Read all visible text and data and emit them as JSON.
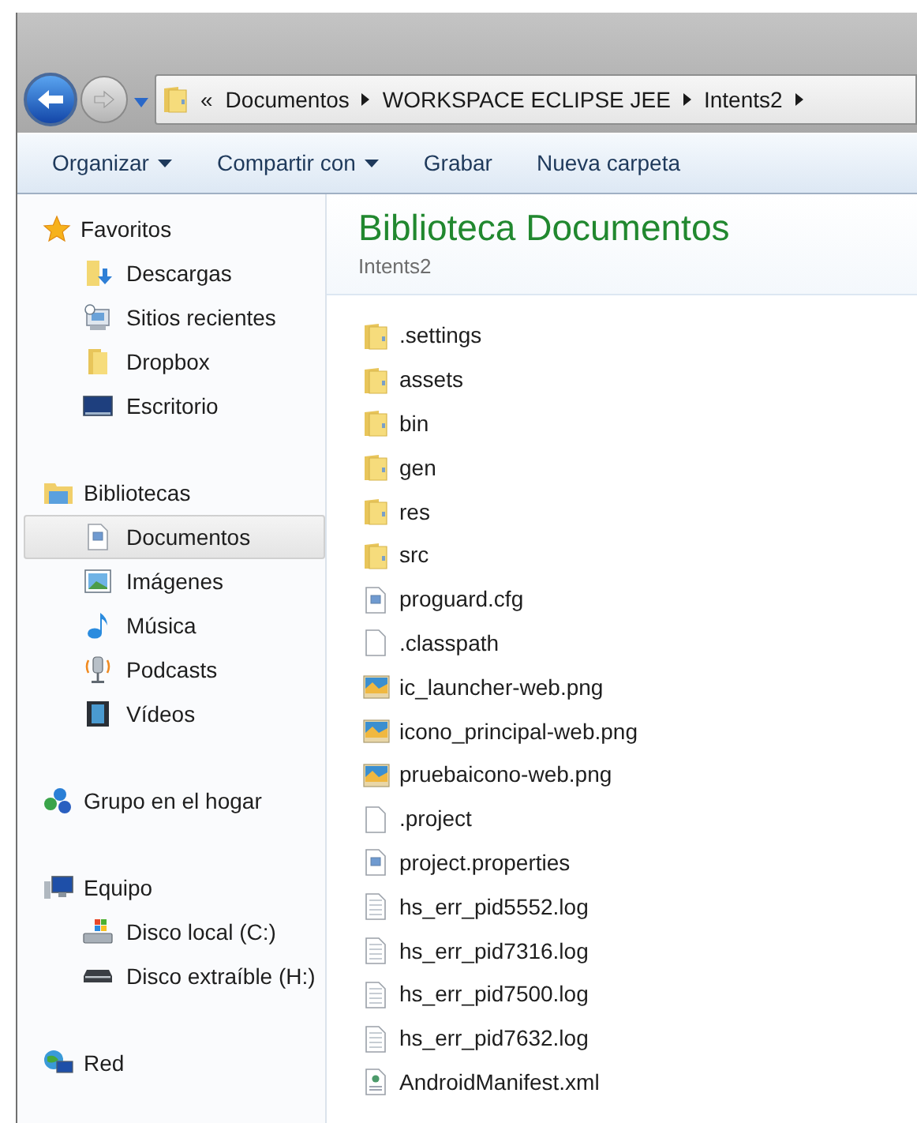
{
  "navigation": {
    "breadcrumb": [
      "«",
      "Documentos",
      "WORKSPACE ECLIPSE JEE",
      "Intents2"
    ]
  },
  "toolbar": [
    {
      "label": "Organizar",
      "dropdown": true
    },
    {
      "label": "Compartir con",
      "dropdown": true
    },
    {
      "label": "Grabar",
      "dropdown": false
    },
    {
      "label": "Nueva carpeta",
      "dropdown": false
    }
  ],
  "sidebar": {
    "groups": [
      {
        "label": "Favoritos",
        "children": [
          {
            "label": "Descargas",
            "selected": false
          },
          {
            "label": "Sitios recientes",
            "selected": false
          },
          {
            "label": "Dropbox",
            "selected": false
          },
          {
            "label": "Escritorio",
            "selected": false
          }
        ]
      },
      {
        "label": "Bibliotecas",
        "children": [
          {
            "label": "Documentos",
            "selected": true
          },
          {
            "label": "Imágenes",
            "selected": false
          },
          {
            "label": "Música",
            "selected": false
          },
          {
            "label": "Podcasts",
            "selected": false
          },
          {
            "label": "Vídeos",
            "selected": false
          }
        ]
      },
      {
        "label": "Grupo en el hogar"
      },
      {
        "label": "Equipo",
        "children": [
          {
            "label": "Disco local (C:)",
            "selected": false
          },
          {
            "label": "Disco extraíble (H:)",
            "selected": false
          }
        ]
      },
      {
        "label": "Red"
      }
    ]
  },
  "content": {
    "title": "Biblioteca Documentos",
    "subtitle": "Intents2",
    "files": [
      {
        "name": ".settings",
        "kind": "folder"
      },
      {
        "name": "assets",
        "kind": "folder"
      },
      {
        "name": "bin",
        "kind": "folder"
      },
      {
        "name": "gen",
        "kind": "folder"
      },
      {
        "name": "res",
        "kind": "folder"
      },
      {
        "name": "src",
        "kind": "folder"
      },
      {
        "name": "proguard.cfg",
        "kind": "config"
      },
      {
        "name": ".classpath",
        "kind": "blank"
      },
      {
        "name": "ic_launcher-web.png",
        "kind": "image"
      },
      {
        "name": "icono_principal-web.png",
        "kind": "image"
      },
      {
        "name": "pruebaicono-web.png",
        "kind": "image"
      },
      {
        "name": ".project",
        "kind": "blank"
      },
      {
        "name": "project.properties",
        "kind": "config"
      },
      {
        "name": "hs_err_pid5552.log",
        "kind": "log"
      },
      {
        "name": "hs_err_pid7316.log",
        "kind": "log"
      },
      {
        "name": "hs_err_pid7500.log",
        "kind": "log"
      },
      {
        "name": "hs_err_pid7632.log",
        "kind": "log"
      },
      {
        "name": "AndroidManifest.xml",
        "kind": "xml"
      }
    ]
  }
}
